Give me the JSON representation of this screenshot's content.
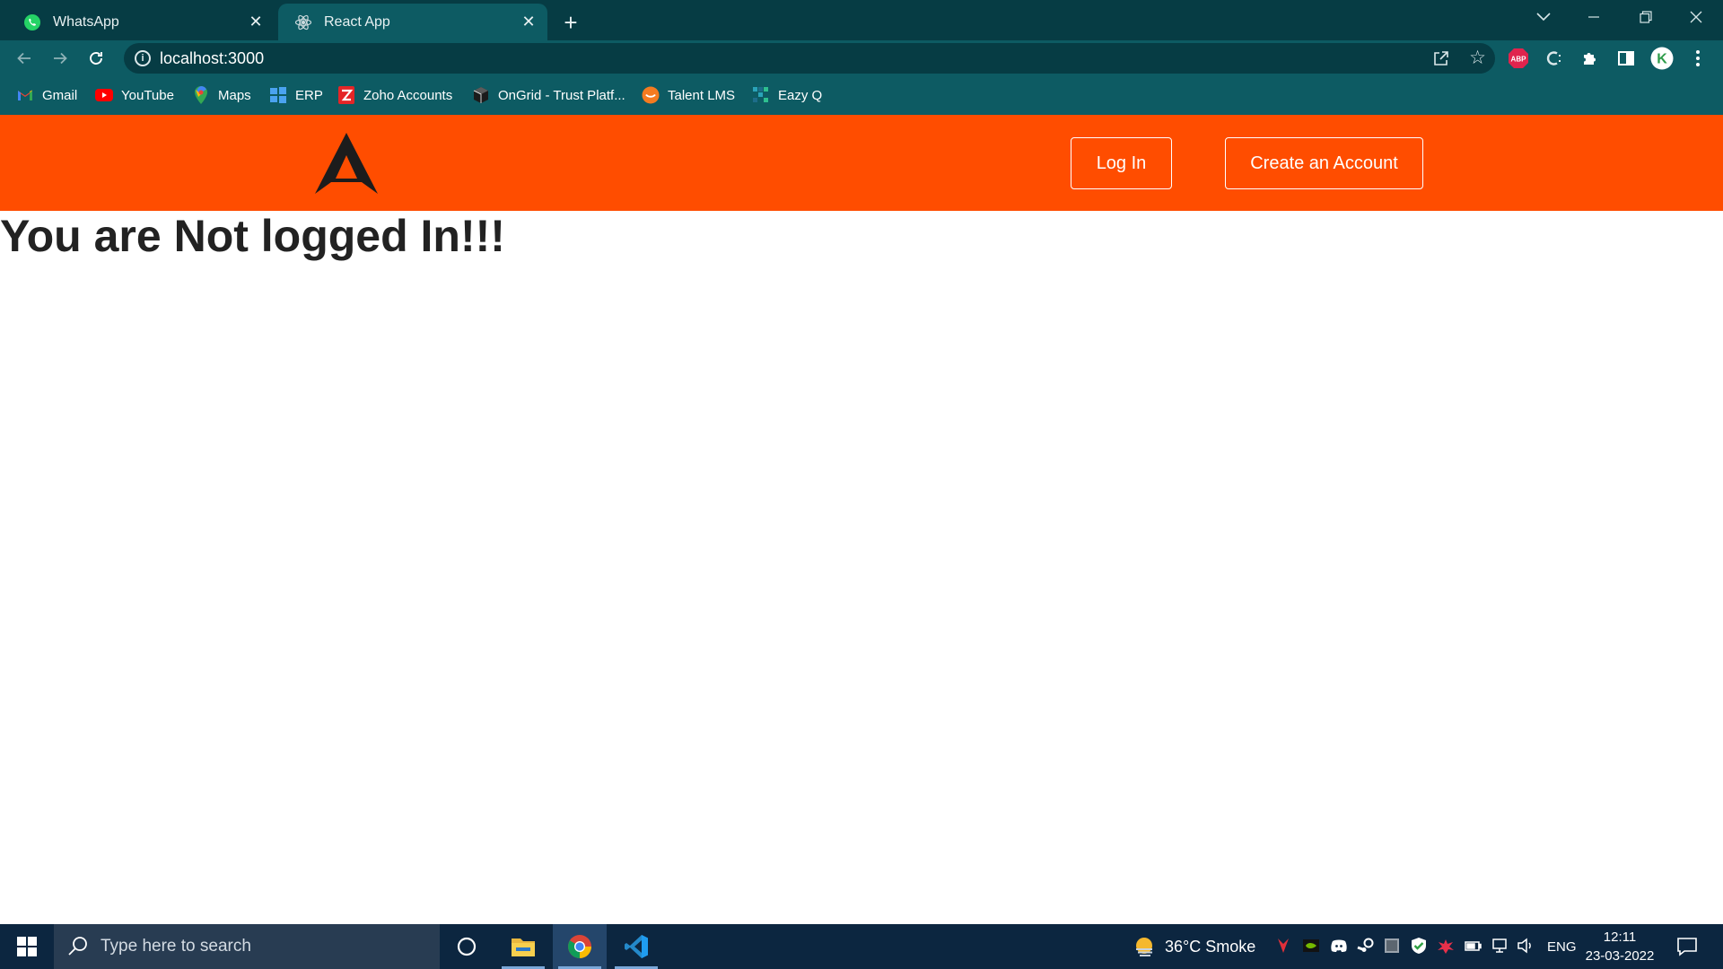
{
  "browser": {
    "tabs": [
      {
        "title": "WhatsApp",
        "icon": "whatsapp-icon",
        "active": false
      },
      {
        "title": "React App",
        "icon": "react-icon",
        "active": true
      }
    ],
    "address": {
      "url": "localhost:3000"
    },
    "bookmarks": [
      {
        "label": "Gmail",
        "icon": "gmail-icon"
      },
      {
        "label": "YouTube",
        "icon": "youtube-icon"
      },
      {
        "label": "Maps",
        "icon": "maps-icon"
      },
      {
        "label": "ERP",
        "icon": "windows-grid-icon"
      },
      {
        "label": "Zoho Accounts",
        "icon": "zoho-icon"
      },
      {
        "label": "OnGrid - Trust Platf...",
        "icon": "ongrid-icon"
      },
      {
        "label": "Talent LMS",
        "icon": "talentlms-icon"
      },
      {
        "label": "Eazy Q",
        "icon": "eazyq-icon"
      }
    ],
    "extensions": {
      "adblock_label": "ABP",
      "profile_initial": "K"
    }
  },
  "app": {
    "nav": {
      "login_label": "Log In",
      "signup_label": "Create an Account"
    },
    "heading": "You are Not logged In!!!"
  },
  "taskbar": {
    "search_placeholder": "Type here to search",
    "weather": "36°C  Smoke",
    "language": "ENG",
    "time": "12:11",
    "date": "23-03-2022"
  },
  "colors": {
    "chrome_dark": "#063c44",
    "chrome_active": "#0d5b63",
    "app_accent": "#ff4d00",
    "taskbar": "#0c2640"
  }
}
